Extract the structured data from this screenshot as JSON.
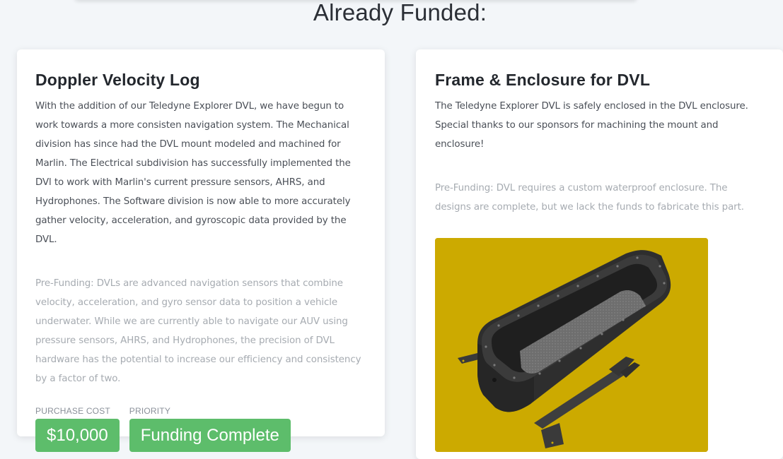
{
  "section": {
    "title": "Already Funded:"
  },
  "cards": [
    {
      "title": "Doppler Velocity Log",
      "description": "With the addition of our Teledyne Explorer DVL, we have begun to work towards a more consisten navigation system. The Mechanical division has since had the DVL mount modeled and machined for Marlin. The Electrical subdivision has successfully implemented the DVl to work with Marlin's current pressure sensors, AHRS, and Hydrophones. The Software division is now able to more accurately gather velocity, acceleration, and gyroscopic data provided by the DVL.",
      "prefunding": "Pre-Funding: DVLs are advanced navigation sensors that combine velocity, acceleration, and gyro sensor data to position a vehicle underwater. While we are currently able to navigate our AUV using pressure sensors, AHRS, and Hydrophones, the precision of DVL hardware has the potential to increase our efficiency and consistency by a factor of two.",
      "purchase_cost_label": "PURCHASE COST",
      "purchase_cost": "$10,000",
      "priority_label": "PRIORITY",
      "priority": "Funding Complete"
    },
    {
      "title": "Frame & Enclosure for DVL",
      "description": "The Teledyne Explorer DVL is safely enclosed in the DVL enclosure. Special thanks to our sponsors for machining the mount and enclosure!",
      "prefunding": "Pre-Funding: DVL requires a custom waterproof enclosure. The designs are complete, but we lack the funds to fabricate this part."
    }
  ],
  "colors": {
    "accent_green": "#5dbd6b",
    "image_background": "#ccaa00",
    "page_background": "#f3f6f9"
  }
}
